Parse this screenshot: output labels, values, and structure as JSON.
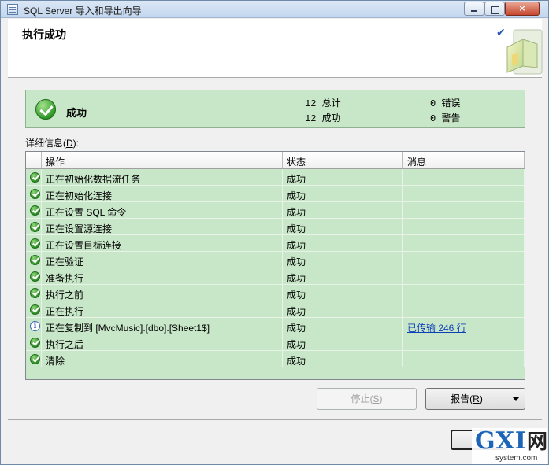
{
  "window": {
    "title": "SQL Server 导入和导出向导",
    "buttons": {
      "minimize": "",
      "maximize": "",
      "close": "×"
    }
  },
  "header": {
    "title": "执行成功",
    "check_glyph": "✔"
  },
  "summary": {
    "status": "成功",
    "total_label": "12 总计",
    "success_label": "12 成功",
    "error_label": "0 错误",
    "warning_label": "0 警告"
  },
  "details": {
    "label_prefix": "详细信息(",
    "label_key": "D",
    "label_suffix": "):",
    "columns": [
      "操作",
      "状态",
      "消息"
    ],
    "rows": [
      {
        "icon": "success-icon",
        "action": "正在初始化数据流任务",
        "status": "成功",
        "message": ""
      },
      {
        "icon": "success-icon",
        "action": "正在初始化连接",
        "status": "成功",
        "message": ""
      },
      {
        "icon": "success-icon",
        "action": "正在设置 SQL 命令",
        "status": "成功",
        "message": ""
      },
      {
        "icon": "success-icon",
        "action": "正在设置源连接",
        "status": "成功",
        "message": ""
      },
      {
        "icon": "success-icon",
        "action": "正在设置目标连接",
        "status": "成功",
        "message": ""
      },
      {
        "icon": "success-icon",
        "action": "正在验证",
        "status": "成功",
        "message": ""
      },
      {
        "icon": "success-icon",
        "action": "准备执行",
        "status": "成功",
        "message": ""
      },
      {
        "icon": "success-icon",
        "action": "执行之前",
        "status": "成功",
        "message": ""
      },
      {
        "icon": "success-icon",
        "action": "正在执行",
        "status": "成功",
        "message": ""
      },
      {
        "icon": "info-icon",
        "action": "正在复制到 [MvcMusic].[dbo].[Sheet1$]",
        "status": "成功",
        "message": "已传输 246 行"
      },
      {
        "icon": "success-icon",
        "action": "执行之后",
        "status": "成功",
        "message": ""
      },
      {
        "icon": "success-icon",
        "action": "清除",
        "status": "成功",
        "message": ""
      }
    ]
  },
  "buttons": {
    "stop_prefix": "停止(",
    "stop_key": "S",
    "stop_suffix": ")",
    "report_prefix": "报告(",
    "report_key": "R",
    "report_suffix": ")"
  },
  "watermark": {
    "main": "GXI",
    "main_cn": "网",
    "sub": "system.com"
  },
  "colors": {
    "success_panel": "#c8e6c8",
    "link": "#0b3fb8"
  }
}
